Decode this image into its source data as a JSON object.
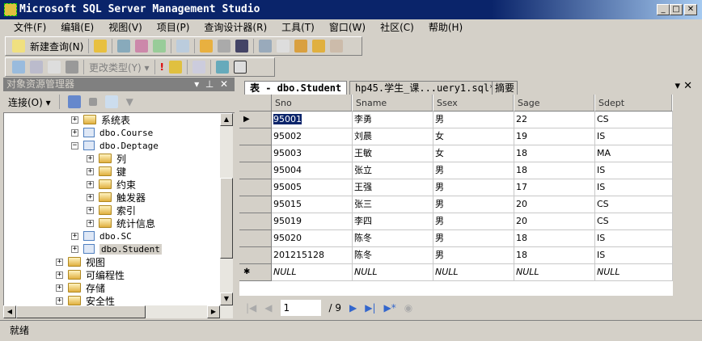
{
  "window": {
    "title": "Microsoft SQL Server Management Studio"
  },
  "menu": [
    "文件(F)",
    "编辑(E)",
    "视图(V)",
    "项目(P)",
    "查询设计器(R)",
    "工具(T)",
    "窗口(W)",
    "社区(C)",
    "帮助(H)"
  ],
  "toolbar": {
    "new_query": "新建查询(N)",
    "change_type": "更改类型(Y) ▾"
  },
  "explorer": {
    "title": "对象资源管理器",
    "connect": "连接(O) ▾",
    "tree": [
      {
        "label": "系统表",
        "level": 1,
        "type": "folder",
        "expanded": false
      },
      {
        "label": "dbo.Course",
        "level": 1,
        "type": "table",
        "expanded": false
      },
      {
        "label": "dbo.Deptage",
        "level": 1,
        "type": "table",
        "expanded": true
      },
      {
        "label": "列",
        "level": 2,
        "type": "folder",
        "expanded": false
      },
      {
        "label": "键",
        "level": 2,
        "type": "folder",
        "expanded": false
      },
      {
        "label": "约束",
        "level": 2,
        "type": "folder",
        "expanded": false
      },
      {
        "label": "触发器",
        "level": 2,
        "type": "folder",
        "expanded": false
      },
      {
        "label": "索引",
        "level": 2,
        "type": "folder",
        "expanded": false
      },
      {
        "label": "统计信息",
        "level": 2,
        "type": "folder",
        "expanded": false
      },
      {
        "label": "dbo.SC",
        "level": 1,
        "type": "table",
        "expanded": false
      },
      {
        "label": "dbo.Student",
        "level": 1,
        "type": "table",
        "expanded": false,
        "selected": true
      },
      {
        "label": "视图",
        "level": 0,
        "type": "folder",
        "expanded": false
      },
      {
        "label": "可编程性",
        "level": 0,
        "type": "folder",
        "expanded": false
      },
      {
        "label": "存储",
        "level": 0,
        "type": "folder",
        "expanded": false
      },
      {
        "label": "安全性",
        "level": 0,
        "type": "folder",
        "expanded": false
      }
    ]
  },
  "tabs": [
    "表 - dbo.Student",
    "hp45.学生_课...uery1.sql*",
    "摘要"
  ],
  "grid": {
    "columns": [
      "Sno",
      "Sname",
      "Ssex",
      "Sage",
      "Sdept"
    ],
    "rows": [
      [
        "95001",
        "李勇",
        "男",
        "22",
        "CS"
      ],
      [
        "95002",
        "刘晨",
        "女",
        "19",
        "IS"
      ],
      [
        "95003",
        "王敏",
        "女",
        "18",
        "MA"
      ],
      [
        "95004",
        "张立",
        "男",
        "18",
        "IS"
      ],
      [
        "95005",
        "王强",
        "男",
        "17",
        "IS"
      ],
      [
        "95015",
        "张三",
        "男",
        "20",
        "CS"
      ],
      [
        "95019",
        "李四",
        "男",
        "20",
        "CS"
      ],
      [
        "95020",
        "陈冬",
        "男",
        "18",
        "IS"
      ],
      [
        "201215128",
        "陈冬",
        "男",
        "18",
        "IS"
      ],
      [
        "NULL",
        "NULL",
        "NULL",
        "NULL",
        "NULL"
      ]
    ]
  },
  "nav": {
    "page": "1",
    "total": "/ 9"
  },
  "status": "就绪"
}
